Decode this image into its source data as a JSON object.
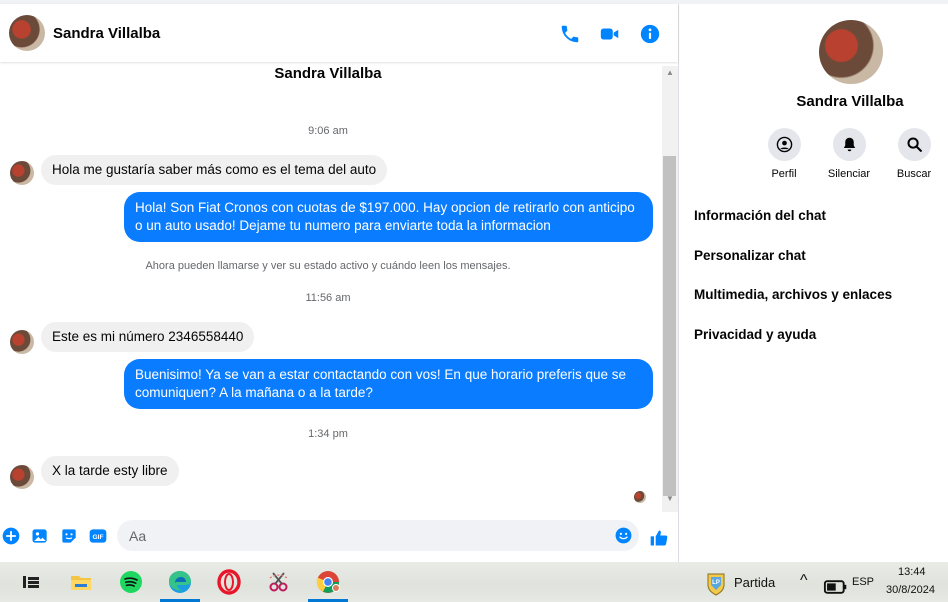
{
  "header": {
    "contact_name": "Sandra Villalba",
    "icons": [
      "phone-icon",
      "video-icon",
      "info-icon"
    ]
  },
  "conversation": {
    "top_name": "Sandra Villalba",
    "time_1": "9:06 am",
    "msg_in_1": "Hola me gustaría saber más como es el tema del auto",
    "msg_out_1": "Hola! Son Fiat Cronos con cuotas de $197.000. Hay opcion de retirarlo con anticipo o un auto usado! Dejame tu numero para enviarte toda la informacion",
    "system_note": "Ahora pueden llamarse y ver su estado activo y cuándo leen los mensajes.",
    "time_2": "11:56 am",
    "msg_in_2": "Este es mi número 2346558440",
    "msg_out_2": "Buenisimo! Ya se van a estar contactando con vos! En que horario preferis que se comuniquen? A la mañana o a la tarde?",
    "time_3": "1:34 pm",
    "msg_in_3": "X la tarde esty libre"
  },
  "composer": {
    "placeholder": "Aa",
    "icons": [
      "plus-icon",
      "photo-icon",
      "sticker-icon",
      "gif-icon",
      "emoji-icon",
      "like-icon"
    ]
  },
  "panel": {
    "name": "Sandra Villalba",
    "actions": [
      {
        "label": "Perfil",
        "icon": "profile-icon"
      },
      {
        "label": "Silenciar",
        "icon": "bell-icon"
      },
      {
        "label": "Buscar",
        "icon": "search-icon"
      }
    ],
    "menu": [
      "Información del chat",
      "Personalizar chat",
      "Multimedia, archivos y enlaces",
      "Privacidad y ayuda"
    ]
  },
  "taskbar": {
    "apps": [
      "task-view-icon",
      "file-explorer-icon",
      "spotify-icon",
      "edge-icon",
      "opera-icon",
      "snipping-tool-icon",
      "chrome-icon"
    ],
    "weather_label": "Partida",
    "language": "ESP",
    "time": "13:44",
    "date": "30/8/2024"
  },
  "colors": {
    "accent": "#0a7cff",
    "messenger_blue": "#0084ff",
    "incoming_bubble": "#f0f0f0"
  }
}
